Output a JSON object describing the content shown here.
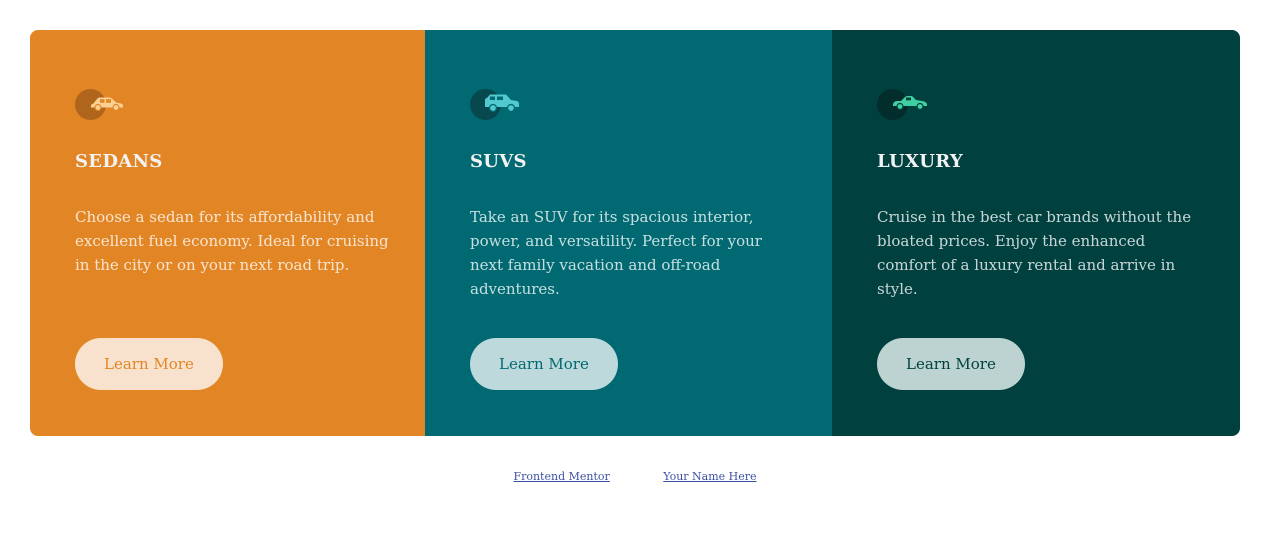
{
  "cards": [
    {
      "title": "SEDANS",
      "description": "Choose a sedan for its affordability and excellent fuel economy. Ideal for cruising in the city or on your next road trip.",
      "button_label": "Learn More",
      "icon": "sedan-car-icon",
      "color": "#e28625"
    },
    {
      "title": "SUVS",
      "description": "Take an SUV for its spacious interior, power, and versatility. Perfect for your next family vacation and off-road adventures.",
      "button_label": "Learn More",
      "icon": "suv-car-icon",
      "color": "#006971"
    },
    {
      "title": "LUXURY",
      "description": "Cruise in the best car brands without the bloated prices. Enjoy the enhanced comfort of a luxury rental and arrive in style.",
      "button_label": "Learn More",
      "icon": "luxury-car-icon",
      "color": "#004140"
    }
  ],
  "attribution": {
    "challenge_link": "Frontend Mentor",
    "author_link": "Your Name Here",
    "link_color": "#3e52a3"
  }
}
